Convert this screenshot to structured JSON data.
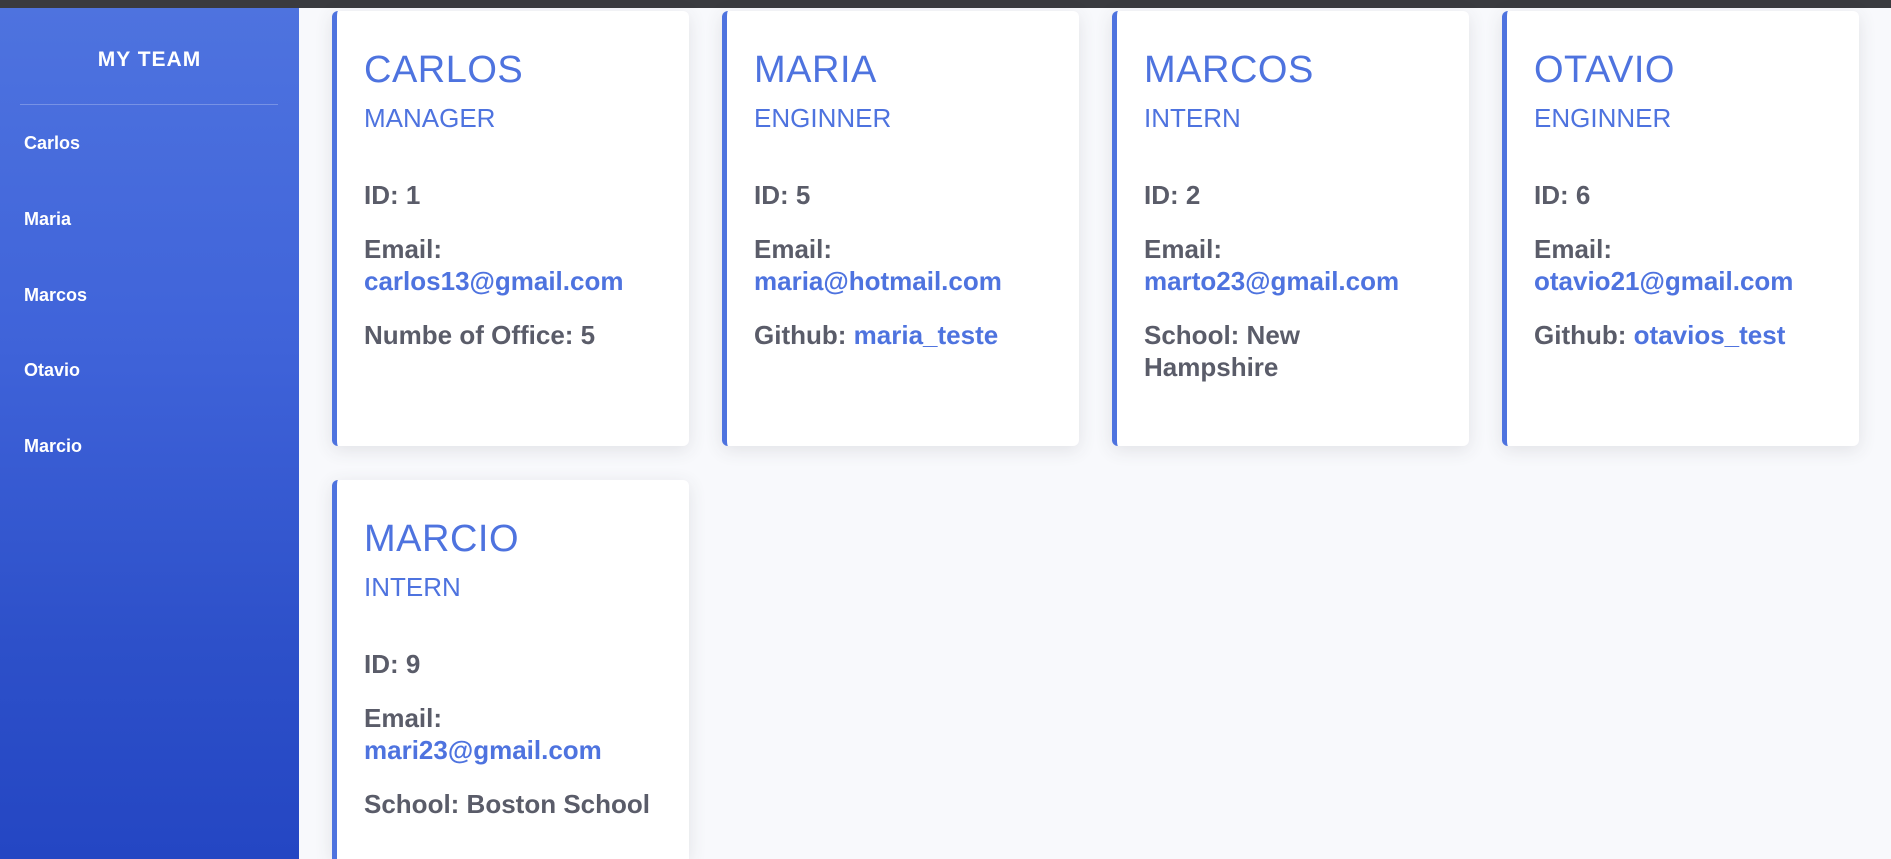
{
  "sidebar": {
    "title": "MY TEAM",
    "items": [
      {
        "label": "Carlos"
      },
      {
        "label": "Maria"
      },
      {
        "label": "Marcos"
      },
      {
        "label": "Otavio"
      },
      {
        "label": "Marcio"
      }
    ]
  },
  "cards": [
    {
      "name": "CARLOS",
      "role": "MANAGER",
      "id": "ID: 1",
      "email_label": "Email:",
      "email": "carlos13@gmail.com",
      "extra_label": "Numbe of Office: 5",
      "extra_value": ""
    },
    {
      "name": "MARIA",
      "role": "ENGINNER",
      "id": "ID: 5",
      "email_label": "Email:",
      "email": "maria@hotmail.com",
      "extra_label": "Github:",
      "extra_value": "maria_teste"
    },
    {
      "name": "MARCOS",
      "role": "INTERN",
      "id": "ID: 2",
      "email_label": "Email:",
      "email": "marto23@gmail.com",
      "extra_label": "School: New Hampshire",
      "extra_value": ""
    },
    {
      "name": "OTAVIO",
      "role": "ENGINNER",
      "id": "ID: 6",
      "email_label": "Email:",
      "email": "otavio21@gmail.com",
      "extra_label": "Github:",
      "extra_value": "otavios_test"
    },
    {
      "name": "MARCIO",
      "role": "INTERN",
      "id": "ID: 9",
      "email_label": "Email:",
      "email": "mari23@gmail.com",
      "extra_label": "School: Boston School",
      "extra_value": ""
    }
  ],
  "colors": {
    "accent": "#4e73df",
    "text": "#5a5c69",
    "background": "#f8f9fc",
    "sidebar_top": "#4e73df",
    "sidebar_bottom": "#2446c3"
  }
}
